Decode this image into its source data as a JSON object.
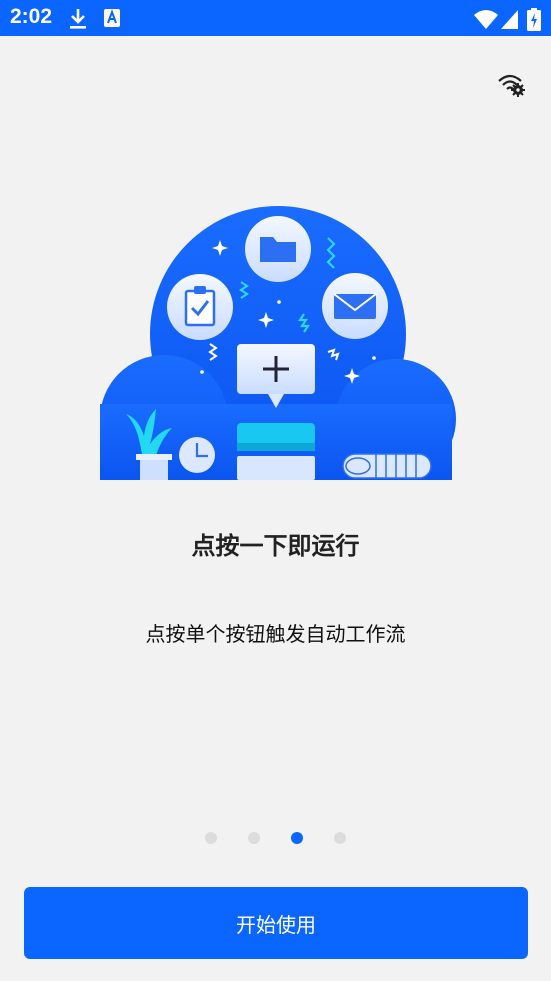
{
  "status_bar": {
    "time": "2:02",
    "icons": [
      "download-icon",
      "font-app-icon",
      "wifi-icon",
      "signal-icon",
      "battery-charging-icon"
    ]
  },
  "header": {
    "settings_icon": "wifi-settings-icon"
  },
  "onboarding": {
    "title": "点按一下即运行",
    "description": "点按单个按钮触发自动工作流",
    "page_index": 3,
    "page_count": 4
  },
  "actions": {
    "start_label": "开始使用"
  },
  "colors": {
    "accent": "#0a66ff",
    "background": "#f2f2f2"
  }
}
